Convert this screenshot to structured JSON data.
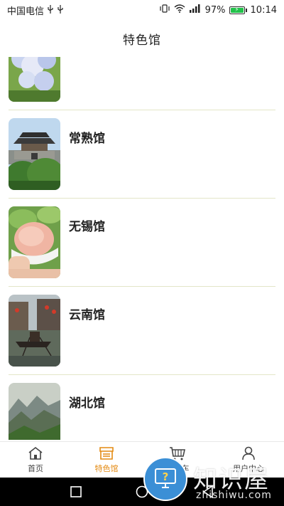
{
  "status_bar": {
    "carrier": "中国电信",
    "battery_percent": "97%",
    "time": "10:14",
    "icons": [
      "usb-icon",
      "usb-icon",
      "vibrate-icon",
      "wifi-icon",
      "signal-icon",
      "battery-icon"
    ]
  },
  "header": {
    "title": "特色馆"
  },
  "pavilions": [
    {
      "name": "",
      "image": "hydrangea-flower-photo"
    },
    {
      "name": "常熟馆",
      "image": "city-gate-tower-photo"
    },
    {
      "name": "无锡馆",
      "image": "peach-in-hand-photo"
    },
    {
      "name": "云南馆",
      "image": "water-town-boats-photo"
    },
    {
      "name": "湖北馆",
      "image": "mountain-landscape-photo"
    }
  ],
  "tabs": [
    {
      "label": "首页",
      "icon": "home-icon",
      "active": false
    },
    {
      "label": "特色馆",
      "icon": "storefront-icon",
      "active": true
    },
    {
      "label": "购物车",
      "icon": "cart-icon",
      "active": false
    },
    {
      "label": "用户中心",
      "icon": "user-icon",
      "active": false
    }
  ],
  "nav": {
    "icons": [
      "square-icon",
      "circle-icon",
      "back-icon"
    ]
  },
  "watermark": {
    "text": "知识屋",
    "url": "zhishiwu.com",
    "colors": {
      "badge": "#3b8fd6"
    }
  },
  "colors": {
    "accent": "#e48a12",
    "divider": "#e3e6c8"
  }
}
